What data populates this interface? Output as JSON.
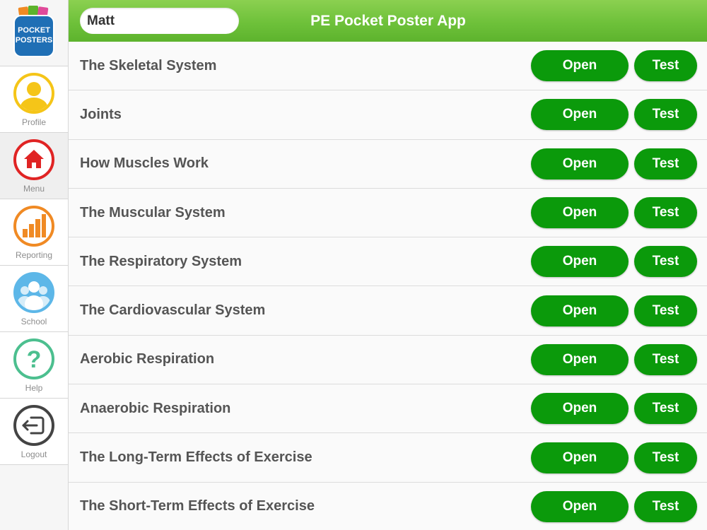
{
  "app": {
    "title": "PE Pocket Poster App"
  },
  "logo": {
    "line1": "POCKET",
    "line2": "POSTERS"
  },
  "user": {
    "name": "Matt"
  },
  "colors": {
    "header_green": "#6ec13a",
    "button_green": "#0b9a0b",
    "profile": "#f5c518",
    "menu": "#e02424",
    "reporting": "#f08a24",
    "school": "#5db7e8",
    "help": "#4cbf8f",
    "logout": "#444444"
  },
  "sidebar": {
    "items": [
      {
        "label": "Profile",
        "icon": "profile-icon",
        "active": false
      },
      {
        "label": "Menu",
        "icon": "home-icon",
        "active": true
      },
      {
        "label": "Reporting",
        "icon": "bar-chart-icon",
        "active": false
      },
      {
        "label": "School",
        "icon": "group-icon",
        "active": false
      },
      {
        "label": "Help",
        "icon": "question-icon",
        "active": false
      },
      {
        "label": "Logout",
        "icon": "logout-icon",
        "active": false
      }
    ]
  },
  "buttons": {
    "open": "Open",
    "test": "Test"
  },
  "topics": [
    "The Skeletal System",
    "Joints",
    "How Muscles Work",
    "The Muscular System",
    "The Respiratory System",
    "The Cardiovascular System",
    "Aerobic Respiration",
    "Anaerobic Respiration",
    "The Long-Term Effects of Exercise",
    "The Short-Term Effects of Exercise"
  ]
}
